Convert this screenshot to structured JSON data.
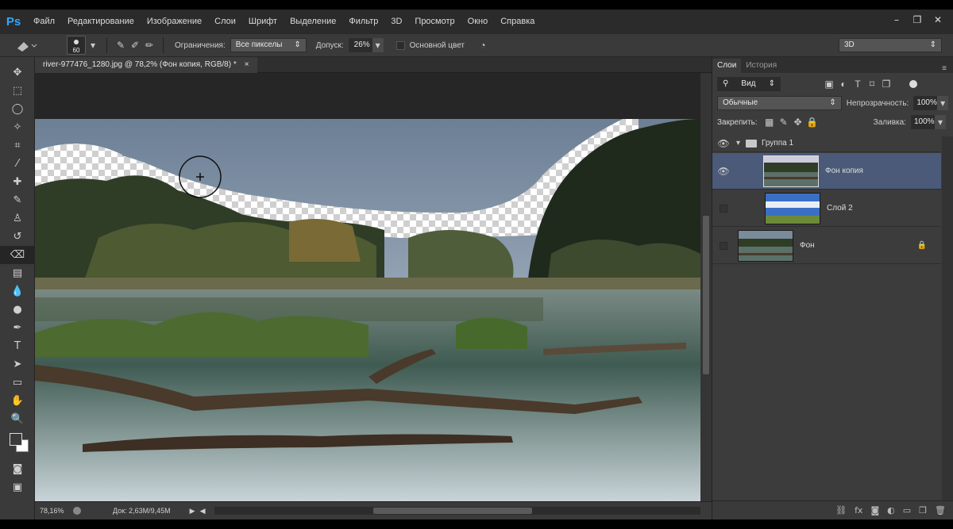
{
  "app": {
    "logo": "Ps"
  },
  "menu": [
    "Файл",
    "Редактирование",
    "Изображение",
    "Слои",
    "Шрифт",
    "Выделение",
    "Фильтр",
    "3D",
    "Просмотр",
    "Окно",
    "Справка"
  ],
  "options": {
    "brush_size": "60",
    "limits_label": "Ограничения:",
    "limits_value": "Все пикселы",
    "tolerance_label": "Допуск:",
    "tolerance_value": "26%",
    "foreground_label": "Основной цвет",
    "workspace": "3D"
  },
  "document": {
    "tab_title": "river-977476_1280.jpg @ 78,2% (Фон копия, RGB/8) *",
    "close": "×"
  },
  "status": {
    "zoom": "78,16%",
    "doc_info": "Док: 2,63M/9,45M"
  },
  "panel": {
    "tabs": [
      "Слои",
      "История"
    ],
    "filter": "Вид",
    "blend_mode": "Обычные",
    "opacity_label": "Непрозрачность:",
    "opacity_value": "100%",
    "lock_label": "Закрепить:",
    "fill_label": "Заливка:",
    "fill_value": "100%"
  },
  "layers": [
    {
      "name": "Группа 1",
      "type": "group",
      "visible": true
    },
    {
      "name": "Фон копия",
      "type": "layer",
      "visible": true,
      "selected": true
    },
    {
      "name": "Слой 2",
      "type": "layer",
      "visible": false
    },
    {
      "name": "Фон",
      "type": "background",
      "visible": false,
      "locked": true
    }
  ],
  "colors": {
    "accent": "#31a8ff",
    "selected_layer": "#4a5a78"
  }
}
